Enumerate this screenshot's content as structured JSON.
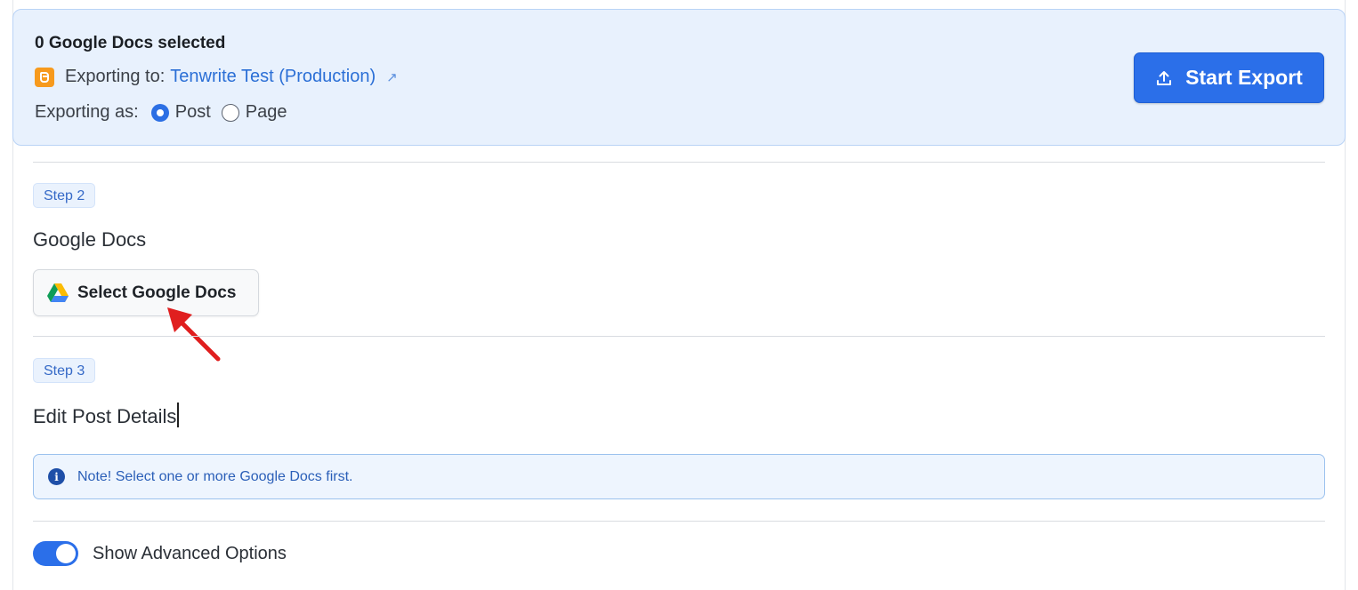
{
  "export_bar": {
    "selected_count": "0 Google Docs selected",
    "exporting_to_label": "Exporting to:",
    "site_name": "Tenwrite Test (Production)",
    "exporting_as_label": "Exporting as:",
    "export_as_options": [
      {
        "label": "Post",
        "checked": true
      },
      {
        "label": "Page",
        "checked": false
      }
    ],
    "start_export_label": "Start Export"
  },
  "step2": {
    "badge": "Step 2",
    "title": "Google Docs",
    "button_label": "Select Google Docs"
  },
  "step3": {
    "badge": "Step 3",
    "title": "Edit Post Details",
    "note": "Note! Select one or more Google Docs first."
  },
  "advanced": {
    "label": "Show Advanced Options",
    "enabled": true
  },
  "colors": {
    "accent": "#2b6fe9",
    "bar_background": "#e8f1fd",
    "annotation_arrow": "#e01f1f",
    "blogger": "#f79a1d"
  }
}
